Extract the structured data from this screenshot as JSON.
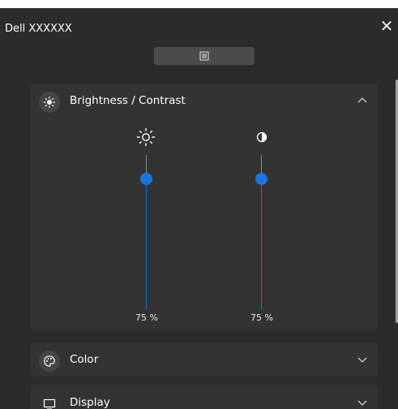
{
  "window": {
    "title": "Dell XXXXXX",
    "close_icon": "close-icon",
    "menu_icon": "menu-icon"
  },
  "panels": {
    "brightness_contrast": {
      "label": "Brightness / Contrast",
      "icon": "brightness-icon",
      "expanded": true,
      "brightness": {
        "icon": "sun-icon",
        "level": 0.75,
        "value_text": "75 %"
      },
      "contrast": {
        "icon": "contrast-icon",
        "level": 0.75,
        "value_text": "75 %"
      }
    },
    "color": {
      "label": "Color",
      "icon": "palette-icon",
      "expanded": false
    },
    "display": {
      "label": "Display",
      "icon": "display-icon",
      "expanded": false
    }
  },
  "colors": {
    "background": "#2b2b2b",
    "panel": "#333333",
    "accent": "#1a75e0"
  }
}
